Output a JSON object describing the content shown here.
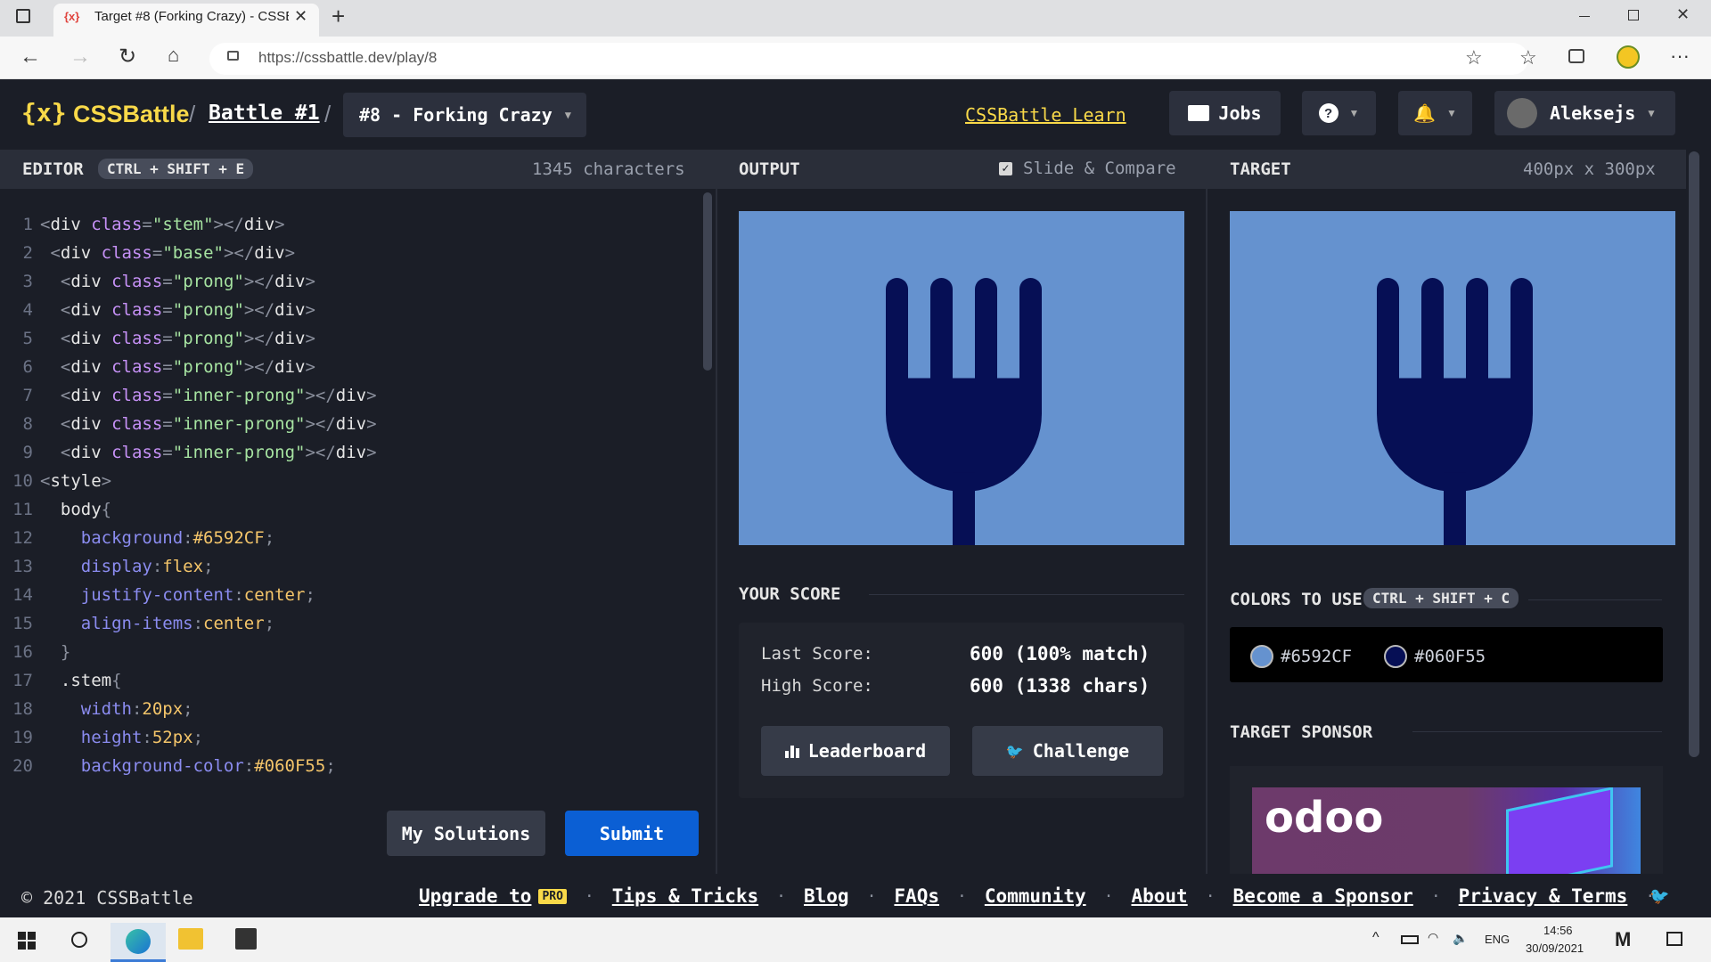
{
  "browser": {
    "tab_title": "Target #8 (Forking Crazy) - CSSB",
    "tab_favicon": "{x}",
    "url": "https://cssbattle.dev/play/8"
  },
  "header": {
    "logo_text": "CSSBattle",
    "logo_mark": "{x}",
    "breadcrumb_sep": "/",
    "battle_link": "Battle #1",
    "target_selector": "#8 - Forking Crazy",
    "learn_link": "CSSBattle Learn",
    "jobs_label": "Jobs",
    "help_label": "?",
    "username": "Aleksejs"
  },
  "editor": {
    "title": "EDITOR",
    "shortcut": "CTRL + SHIFT + E",
    "char_count": "1345 characters",
    "lines": [
      [
        {
          "t": "punc",
          "v": "<"
        },
        {
          "t": "tag",
          "v": "div "
        },
        {
          "t": "attr",
          "v": "class"
        },
        {
          "t": "punc",
          "v": "="
        },
        {
          "t": "str",
          "v": "\"stem\""
        },
        {
          "t": "punc",
          "v": "></"
        },
        {
          "t": "tag",
          "v": "div"
        },
        {
          "t": "punc",
          "v": ">"
        }
      ],
      [
        {
          "t": "punc",
          "v": " <"
        },
        {
          "t": "tag",
          "v": "div "
        },
        {
          "t": "attr",
          "v": "class"
        },
        {
          "t": "punc",
          "v": "="
        },
        {
          "t": "str",
          "v": "\"base\""
        },
        {
          "t": "punc",
          "v": "></"
        },
        {
          "t": "tag",
          "v": "div"
        },
        {
          "t": "punc",
          "v": ">"
        }
      ],
      [
        {
          "t": "punc",
          "v": "  <"
        },
        {
          "t": "tag",
          "v": "div "
        },
        {
          "t": "attr",
          "v": "class"
        },
        {
          "t": "punc",
          "v": "="
        },
        {
          "t": "str",
          "v": "\"prong\""
        },
        {
          "t": "punc",
          "v": "></"
        },
        {
          "t": "tag",
          "v": "div"
        },
        {
          "t": "punc",
          "v": ">"
        }
      ],
      [
        {
          "t": "punc",
          "v": "  <"
        },
        {
          "t": "tag",
          "v": "div "
        },
        {
          "t": "attr",
          "v": "class"
        },
        {
          "t": "punc",
          "v": "="
        },
        {
          "t": "str",
          "v": "\"prong\""
        },
        {
          "t": "punc",
          "v": "></"
        },
        {
          "t": "tag",
          "v": "div"
        },
        {
          "t": "punc",
          "v": ">"
        }
      ],
      [
        {
          "t": "punc",
          "v": "  <"
        },
        {
          "t": "tag",
          "v": "div "
        },
        {
          "t": "attr",
          "v": "class"
        },
        {
          "t": "punc",
          "v": "="
        },
        {
          "t": "str",
          "v": "\"prong\""
        },
        {
          "t": "punc",
          "v": "></"
        },
        {
          "t": "tag",
          "v": "div"
        },
        {
          "t": "punc",
          "v": ">"
        }
      ],
      [
        {
          "t": "punc",
          "v": "  <"
        },
        {
          "t": "tag",
          "v": "div "
        },
        {
          "t": "attr",
          "v": "class"
        },
        {
          "t": "punc",
          "v": "="
        },
        {
          "t": "str",
          "v": "\"prong\""
        },
        {
          "t": "punc",
          "v": "></"
        },
        {
          "t": "tag",
          "v": "div"
        },
        {
          "t": "punc",
          "v": ">"
        }
      ],
      [
        {
          "t": "punc",
          "v": "  <"
        },
        {
          "t": "tag",
          "v": "div "
        },
        {
          "t": "attr",
          "v": "class"
        },
        {
          "t": "punc",
          "v": "="
        },
        {
          "t": "str",
          "v": "\"inner-prong\""
        },
        {
          "t": "punc",
          "v": "></"
        },
        {
          "t": "tag",
          "v": "div"
        },
        {
          "t": "punc",
          "v": ">"
        }
      ],
      [
        {
          "t": "punc",
          "v": "  <"
        },
        {
          "t": "tag",
          "v": "div "
        },
        {
          "t": "attr",
          "v": "class"
        },
        {
          "t": "punc",
          "v": "="
        },
        {
          "t": "str",
          "v": "\"inner-prong\""
        },
        {
          "t": "punc",
          "v": "></"
        },
        {
          "t": "tag",
          "v": "div"
        },
        {
          "t": "punc",
          "v": ">"
        }
      ],
      [
        {
          "t": "punc",
          "v": "  <"
        },
        {
          "t": "tag",
          "v": "div "
        },
        {
          "t": "attr",
          "v": "class"
        },
        {
          "t": "punc",
          "v": "="
        },
        {
          "t": "str",
          "v": "\"inner-prong\""
        },
        {
          "t": "punc",
          "v": "></"
        },
        {
          "t": "tag",
          "v": "div"
        },
        {
          "t": "punc",
          "v": ">"
        }
      ],
      [
        {
          "t": "punc",
          "v": "<"
        },
        {
          "t": "tag",
          "v": "style"
        },
        {
          "t": "punc",
          "v": ">"
        }
      ],
      [
        {
          "t": "sel",
          "v": "  body"
        },
        {
          "t": "punc",
          "v": "{"
        }
      ],
      [
        {
          "t": "prop",
          "v": "    background"
        },
        {
          "t": "punc",
          "v": ":"
        },
        {
          "t": "val",
          "v": "#6592CF"
        },
        {
          "t": "punc",
          "v": ";"
        }
      ],
      [
        {
          "t": "prop",
          "v": "    display"
        },
        {
          "t": "punc",
          "v": ":"
        },
        {
          "t": "val",
          "v": "flex"
        },
        {
          "t": "punc",
          "v": ";"
        }
      ],
      [
        {
          "t": "prop",
          "v": "    justify-content"
        },
        {
          "t": "punc",
          "v": ":"
        },
        {
          "t": "val",
          "v": "center"
        },
        {
          "t": "punc",
          "v": ";"
        }
      ],
      [
        {
          "t": "prop",
          "v": "    align-items"
        },
        {
          "t": "punc",
          "v": ":"
        },
        {
          "t": "val",
          "v": "center"
        },
        {
          "t": "punc",
          "v": ";"
        }
      ],
      [
        {
          "t": "punc",
          "v": "  }"
        }
      ],
      [
        {
          "t": "sel",
          "v": "  .stem"
        },
        {
          "t": "punc",
          "v": "{"
        }
      ],
      [
        {
          "t": "prop",
          "v": "    width"
        },
        {
          "t": "punc",
          "v": ":"
        },
        {
          "t": "val",
          "v": "20px"
        },
        {
          "t": "punc",
          "v": ";"
        }
      ],
      [
        {
          "t": "prop",
          "v": "    height"
        },
        {
          "t": "punc",
          "v": ":"
        },
        {
          "t": "val",
          "v": "52px"
        },
        {
          "t": "punc",
          "v": ";"
        }
      ],
      [
        {
          "t": "prop",
          "v": "    background-color"
        },
        {
          "t": "punc",
          "v": ":"
        },
        {
          "t": "val",
          "v": "#060F55"
        },
        {
          "t": "punc",
          "v": ";"
        }
      ]
    ],
    "my_solutions_label": "My Solutions",
    "submit_label": "Submit"
  },
  "output": {
    "title": "OUTPUT",
    "slide_compare_label": "Slide & Compare",
    "slide_compare_checked": true,
    "score_title": "YOUR SCORE",
    "last_score_label": "Last Score:",
    "last_score_value": "600 (100% match)",
    "high_score_label": "High Score:",
    "high_score_value": "600 (1338 chars)",
    "leaderboard_label": "Leaderboard",
    "challenge_label": "Challenge"
  },
  "target": {
    "title": "TARGET",
    "size": "400px x 300px",
    "colors_title": "COLORS TO USE",
    "colors_shortcut": "CTRL + SHIFT + C",
    "colors": [
      "#6592CF",
      "#060F55"
    ],
    "sponsor_title": "TARGET SPONSOR",
    "sponsor_logo": "odoo"
  },
  "footer": {
    "copyright": "© 2021 CSSBattle",
    "upgrade_label": "Upgrade to",
    "pro_badge": "PRO",
    "links": [
      "Tips & Tricks",
      "Blog",
      "FAQs",
      "Community",
      "About",
      "Become a Sponsor",
      "Privacy & Terms"
    ]
  },
  "taskbar": {
    "language": "ENG",
    "time": "14:56",
    "date": "30/09/2021"
  },
  "colors": {
    "accent_yellow": "#f9d949",
    "canvas_bg": "#6592CF",
    "fork": "#060F55",
    "submit_blue": "#0b5fd4"
  }
}
